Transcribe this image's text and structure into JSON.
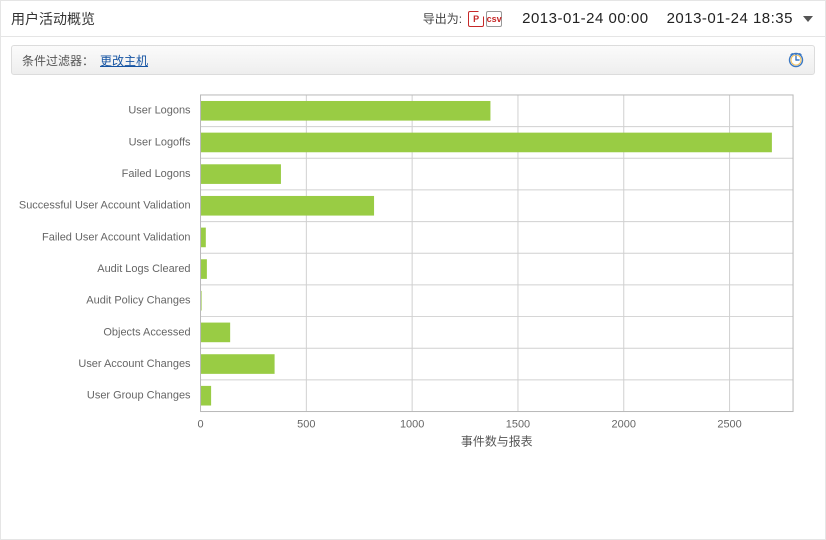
{
  "header": {
    "title": "用户活动概览",
    "export_label": "导出为:",
    "date_start": "2013-01-24 00:00",
    "date_end": "2013-01-24 18:35"
  },
  "filter": {
    "label": "条件过滤器：",
    "link": "更改主机"
  },
  "export_icons": {
    "pdf": "PDF",
    "csv": "csv"
  },
  "chart_data": {
    "type": "bar",
    "orientation": "horizontal",
    "categories": [
      "User Logons",
      "User Logoffs",
      "Failed Logons",
      "Successful User Account Validation",
      "Failed User Account Validation",
      "Audit Logs Cleared",
      "Audit Policy Changes",
      "Objects Accessed",
      "User Account Changes",
      "User Group Changes"
    ],
    "values": [
      1370,
      2700,
      380,
      820,
      25,
      30,
      5,
      140,
      350,
      50
    ],
    "xlabel": "事件数与报表",
    "ylabel": "",
    "xlim": [
      0,
      2800
    ],
    "xticks": [
      0,
      500,
      1000,
      1500,
      2000,
      2500
    ],
    "bar_color": "#99cc44"
  }
}
